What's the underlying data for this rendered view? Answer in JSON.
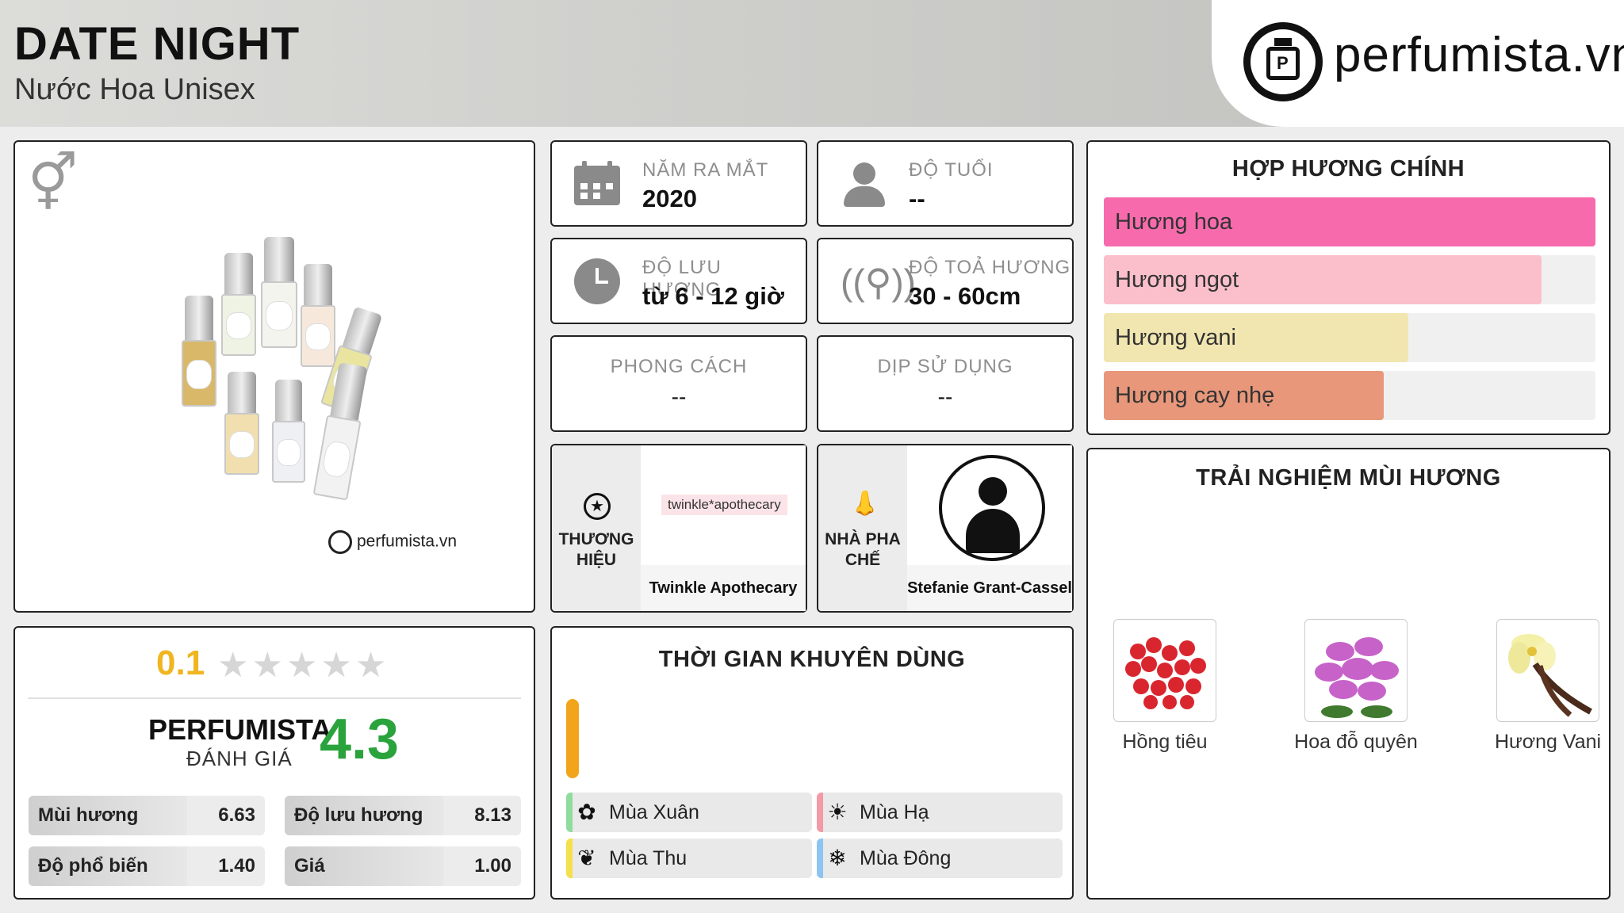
{
  "header": {
    "title": "DATE NIGHT",
    "subtitle": "Nước Hoa Unisex",
    "logo_text": "perfumista.vn"
  },
  "product_image": {
    "gender_icon": "unisex-gender-icon",
    "watermark": "perfumista.vn"
  },
  "info": {
    "year": {
      "label": "NĂM RA MẮT",
      "value": "2020",
      "icon": "calendar-icon"
    },
    "age": {
      "label": "ĐỘ TUỔI",
      "value": "--",
      "icon": "person-icon"
    },
    "longevity": {
      "label": "ĐỘ LƯU HƯƠNG",
      "value": "từ 6 - 12 giờ",
      "icon": "clock-icon"
    },
    "sillage": {
      "label": "ĐỘ TOẢ HƯƠNG",
      "value": "30 - 60cm",
      "icon": "diffusion-icon"
    },
    "style": {
      "label": "PHONG CÁCH",
      "value": "--"
    },
    "occasion": {
      "label": "DỊP SỬ DỤNG",
      "value": "--"
    }
  },
  "brand": {
    "label": "THƯƠNG HIỆU",
    "logo_text": "twinkle*apothecary",
    "name": "Twinkle Apothecary",
    "icon": "star-badge-icon"
  },
  "perfumer": {
    "label": "NHÀ PHA CHẾ",
    "name": "Stefanie Grant-Cassel",
    "icon": "nose-icon"
  },
  "accords": {
    "title": "HỢP HƯƠNG CHÍNH",
    "items": [
      {
        "name": "Hương hoa",
        "percent": 100,
        "color": "#f76bad"
      },
      {
        "name": "Hương ngọt",
        "percent": 89,
        "color": "#fbbfcb"
      },
      {
        "name": "Hương vani",
        "percent": 62,
        "color": "#f1e6b0"
      },
      {
        "name": "Hương cay nhẹ",
        "percent": 57,
        "color": "#e8977a"
      }
    ]
  },
  "experience": {
    "title": "TRẢI NGHIỆM MÙI HƯƠNG",
    "notes": [
      {
        "name": "Hồng tiêu",
        "icon": "pink-pepper-image"
      },
      {
        "name": "Hoa đỗ quyên",
        "icon": "rhododendron-image"
      },
      {
        "name": "Hương Vani",
        "icon": "vanilla-image"
      }
    ]
  },
  "rating": {
    "stars_value": "0.1",
    "stars_max": 5,
    "title": "PERFUMISTA",
    "subtitle": "ĐÁNH GIÁ",
    "score": "4.3",
    "metrics": [
      {
        "label": "Mùi hương",
        "value": "6.63"
      },
      {
        "label": "Độ lưu hương",
        "value": "8.13"
      },
      {
        "label": "Độ phổ biến",
        "value": "1.40"
      },
      {
        "label": "Giá",
        "value": "1.00"
      }
    ]
  },
  "seasons": {
    "title": "THỜI GIAN KHUYÊN DÙNG",
    "items": [
      {
        "name": "Mùa Xuân",
        "icon": "flower-icon",
        "color": "#8fdc9c"
      },
      {
        "name": "Mùa Hạ",
        "icon": "sun-icon",
        "color": "#f39aa6"
      },
      {
        "name": "Mùa Thu",
        "icon": "leaf-icon",
        "color": "#f3e04a"
      },
      {
        "name": "Mùa Đông",
        "icon": "snowflake-icon",
        "color": "#8cc4f2"
      }
    ]
  }
}
